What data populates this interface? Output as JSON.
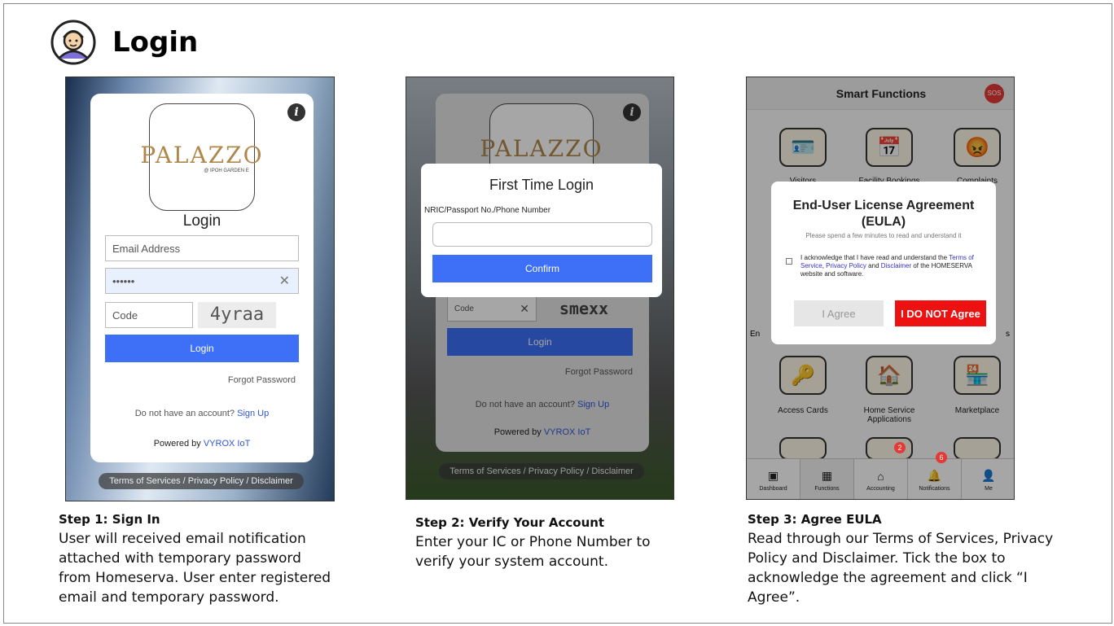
{
  "page": {
    "title": "Login"
  },
  "step1": {
    "logo_text": "PALAZZO",
    "logo_sub": "@ IPOH GARDEN E",
    "heading": "Login",
    "email_placeholder": "Email Address",
    "password_value": "••••••",
    "code_placeholder": "Code",
    "captcha": "4yraa",
    "login_button": "Login",
    "forgot": "Forgot Password",
    "no_account": "Do not have an account?",
    "signup": "Sign Up",
    "powered_by": "Powered by",
    "vendor": "VYROX IoT",
    "footer": "Terms of Services / Privacy Policy / Disclaimer",
    "caption_title": "Step 1: Sign In",
    "caption_text": "User will received email notification attached with temporary password from Homeserva. User enter registered email and temporary password."
  },
  "step2": {
    "dialog_title": "First Time Login",
    "field_label": "NRIC/Passport No./Phone Number",
    "confirm": "Confirm",
    "code_placeholder": "Code",
    "captcha": "smexx",
    "login_button": "Login",
    "forgot": "Forgot Password",
    "no_account": "Do not have an account?",
    "signup": "Sign Up",
    "powered_by": "Powered by",
    "vendor": "VYROX IoT",
    "footer": "Terms of Services / Privacy Policy / Disclaimer",
    "logo_text": "PALAZZO",
    "caption_title": "Step 2: Verify Your Account",
    "caption_text": "Enter your IC or Phone Number to verify your system account."
  },
  "step3": {
    "header": "Smart Functions",
    "sos": "SOS",
    "tiles_top": [
      "Visitors",
      "Facility Bookings",
      "Complaints"
    ],
    "tiles_bottom": [
      "Access Cards",
      "Home Service Applications",
      "Marketplace"
    ],
    "side_left": "En",
    "side_right": "s",
    "eula_title": "End-User License Agreement (EULA)",
    "eula_sub": "Please spend a few minutes to read and understand it",
    "ack_1": "I acknowledge that I have read and understand the",
    "tos": "Terms of Service",
    "pp": "Privacy Policy",
    "and": "and",
    "disc": "Disclaimer",
    "ack_2": "of the HOMESERVA website and software.",
    "agree": "I Agree",
    "disagree": "I DO NOT Agree",
    "nav": [
      "Dashboard",
      "Functions",
      "Accounting",
      "Notifications",
      "Me"
    ],
    "badge_accounting": "2",
    "badge_notifications": "6",
    "caption_title": "Step 3: Agree EULA",
    "caption_text": "Read through our Terms of Services, Privacy Policy and Disclaimer. Tick the box to acknowledge the agreement and click “I Agree”."
  }
}
